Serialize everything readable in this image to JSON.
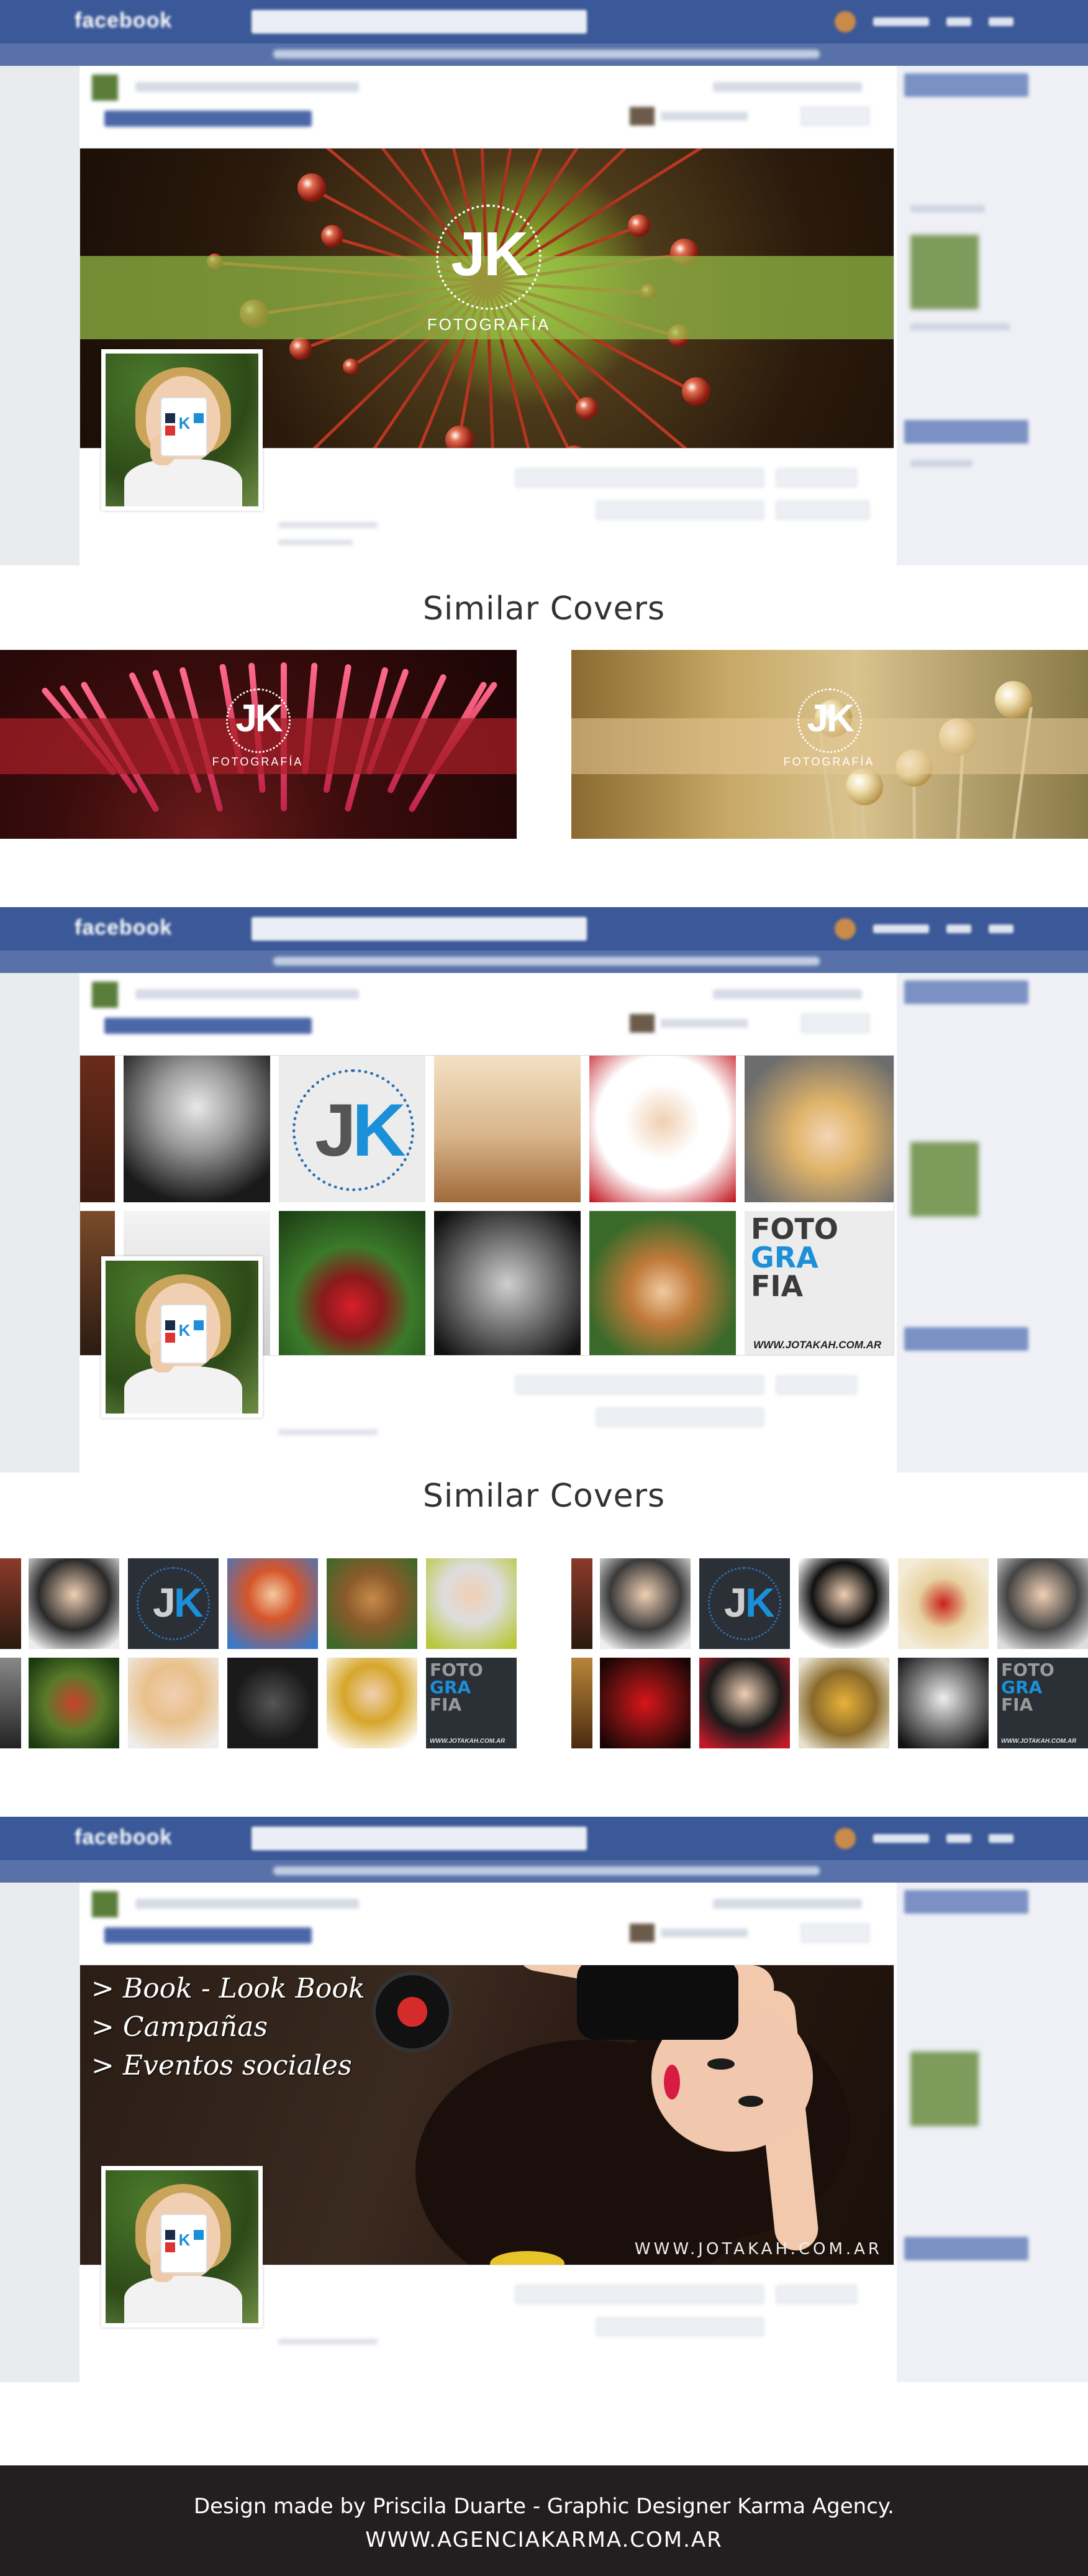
{
  "sections": [
    {
      "similar_heading": "Similar Covers",
      "cover_logo": {
        "jk": "JK",
        "sub": "FOTOGRAFÍA"
      },
      "similar": [
        {
          "logo_jk": "JK",
          "logo_sub": "FOTOGRAFÍA"
        },
        {
          "logo_jk": "JK",
          "logo_sub": "FOTOGRAFÍA"
        }
      ]
    },
    {
      "similar_heading": "Similar Covers",
      "logo_tile": {
        "j": "J",
        "k": "K"
      },
      "foto_tile": {
        "line1": "FOTO",
        "line2": "GRA",
        "line3": "FIA",
        "url": "WWW.JOTAKAH.COM.AR"
      }
    },
    {
      "book_lines": [
        "> Book - Look Book",
        "> Campañas",
        "> Eventos sociales"
      ],
      "url": "WWW.JOTAKAH.COM.AR"
    }
  ],
  "fb": {
    "logo": "facebook"
  },
  "colors": {
    "fb_blue": "#3b5998",
    "jk_blue": "#1b8fd8",
    "footer_bg": "#231f20"
  },
  "footer": {
    "credit": "Design made by Priscila Duarte - Graphic Designer Karma Agency.",
    "url": "WWW.AGENCIAKARMA.COM.AR"
  }
}
